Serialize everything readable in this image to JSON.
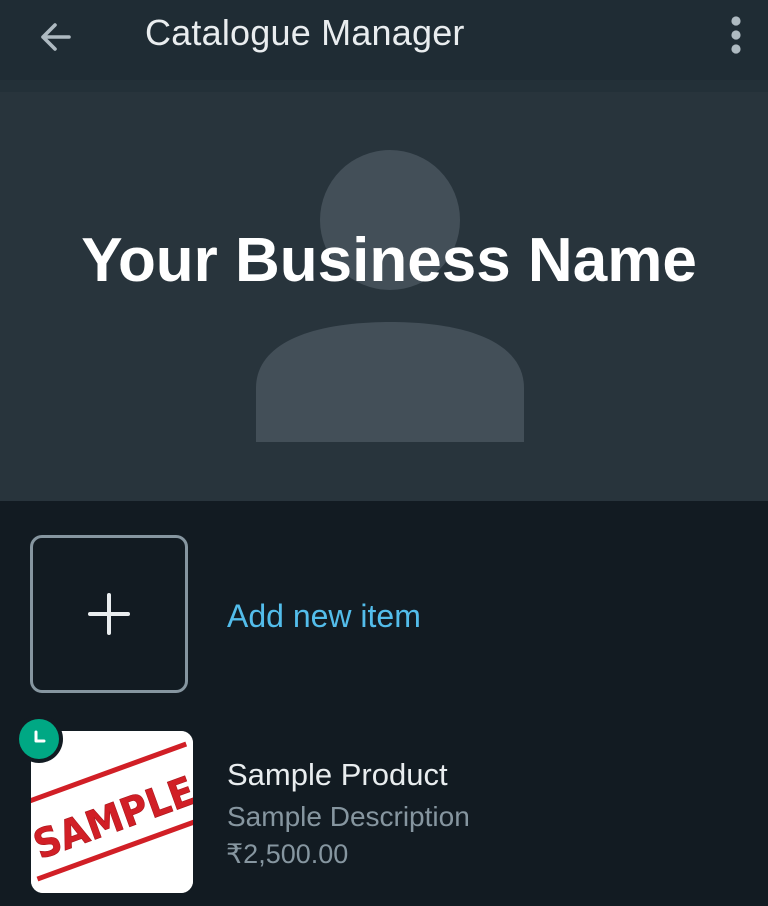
{
  "header": {
    "title": "Catalogue Manager",
    "back_icon": "arrow-left-icon",
    "menu_icon": "more-vertical-icon"
  },
  "cover": {
    "business_name": "Your Business Name",
    "placeholder_icon": "person-placeholder-icon"
  },
  "add_item": {
    "label": "Add new item",
    "icon": "plus-icon"
  },
  "products": [
    {
      "name": "Sample Product",
      "description": "Sample Description",
      "price": "₹2,500.00",
      "image_text": "SAMPLE",
      "status_icon": "clock-icon"
    }
  ],
  "colors": {
    "toolbar_bg": "#1f2c34",
    "cover_bg": "#28343c",
    "page_bg": "#121b22",
    "accent_link": "#53bdeb",
    "badge_green": "#00a884",
    "stamp_red": "#d11f26"
  }
}
